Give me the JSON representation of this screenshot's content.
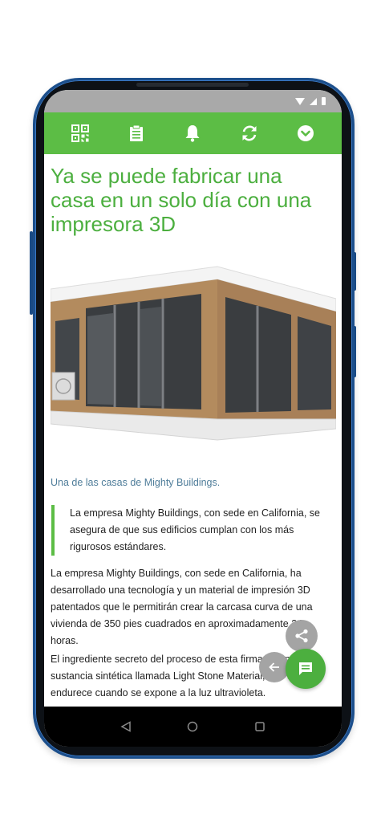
{
  "colors": {
    "accent": "#5cbd45",
    "headline": "#4caf3f",
    "caption": "#4f7d9a",
    "fab_gray": "#a4a4a4",
    "phone_frame": "#1c4f8c"
  },
  "status_bar": {
    "icons": [
      "wifi-icon",
      "signal-icon",
      "battery-icon"
    ]
  },
  "toolbar": {
    "icons": [
      "qr-code-icon",
      "clipboard-icon",
      "bell-icon",
      "refresh-icon",
      "chevron-down-circle-icon"
    ]
  },
  "article": {
    "headline": "Ya se puede fabricar una casa en un solo día con una impresora 3D",
    "image_caption": "Una de las casas de Mighty Buildings.",
    "quote": "La empresa Mighty Buildings, con sede en California, se asegura de que sus edificios cumplan con los más rigurosos estándares.",
    "paragraphs": [
      "La empresa Mighty Buildings, con sede en California, ha desarrollado una tecnología y un material de impresión 3D patentados que le permitirán crear la carcasa curva de una vivienda de 350 pies cuadrados en aproximadamente 24 horas.",
      "El ingrediente secreto del proceso de esta firma es una sustancia sintética llamada Light Stone Material, que se endurece cuando se expone a la luz ultravioleta."
    ]
  },
  "fabs": {
    "icons": [
      "share-icon",
      "arrow-back-icon",
      "comment-icon"
    ]
  },
  "nav_bar": {
    "icons": [
      "back-triangle-icon",
      "home-circle-icon",
      "recents-square-icon"
    ]
  }
}
